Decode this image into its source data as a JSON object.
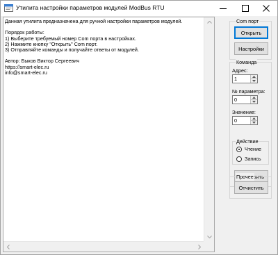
{
  "window": {
    "title": "Утилита настройки параметров модулей ModBus RTU",
    "controls": [
      "minimize-icon",
      "maximize-icon",
      "close-icon"
    ]
  },
  "info_text": {
    "lines": [
      "Данная утилита предназначена для ручной настройки параметров модулей.",
      "",
      "Порядок работы:",
      "1) Выберите требуемый номер Com порта в настройках.",
      "2) Нажмите кнопку \"Открыть\" Com порт.",
      "3) Отправляйте команды и получайте ответы от модулей.",
      "",
      "Автор: Быков Виктор Сергеевич",
      "https://smart-elec.ru",
      "info@smart-elec.ru"
    ]
  },
  "com_port": {
    "label": "Com порт",
    "open_button": "Открыть",
    "settings_button": "Настройки"
  },
  "command": {
    "label": "Команда",
    "address_label": "Адрес:",
    "address_value": "1",
    "param_label": "№ параметра:",
    "param_value": "0",
    "value_label": "Значение:",
    "value_value": "0",
    "action": {
      "label": "Действие",
      "read_label": "Чтение",
      "write_label": "Запись",
      "selected": "read"
    },
    "send_button": "Отправить"
  },
  "other": {
    "label": "Прочее",
    "clear_button": "Отчистить"
  }
}
